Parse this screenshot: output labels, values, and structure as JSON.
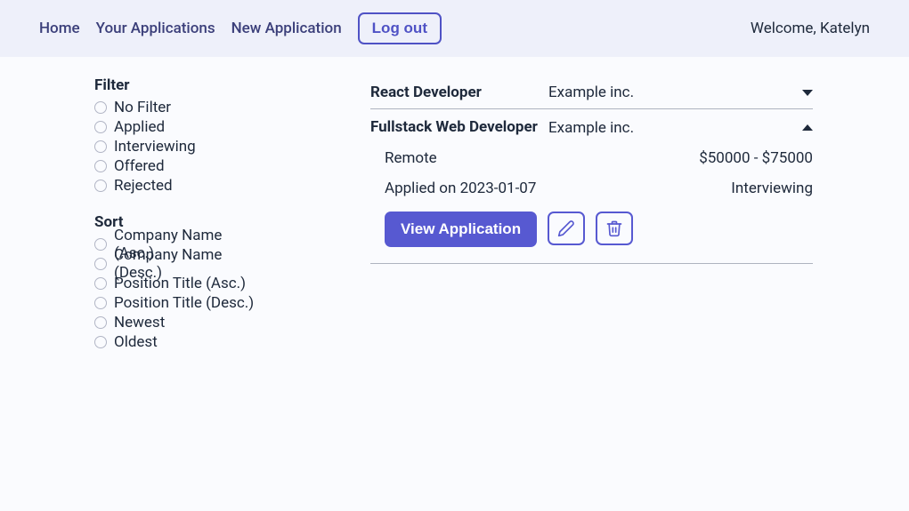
{
  "nav": {
    "home": "Home",
    "your_apps": "Your Applications",
    "new_app": "New Application",
    "logout": "Log out"
  },
  "welcome": "Welcome, Katelyn",
  "sidebar": {
    "filter_heading": "Filter",
    "filters": [
      "No Filter",
      "Applied",
      "Interviewing",
      "Offered",
      "Rejected"
    ],
    "sort_heading": "Sort",
    "sorts": [
      "Company Name (Asc.)",
      "Company Name (Desc.)",
      "Position Title (Asc.)",
      "Position Title (Desc.)",
      "Newest",
      "Oldest"
    ]
  },
  "applications": [
    {
      "title": "React Developer",
      "company": "Example inc.",
      "expanded": false
    },
    {
      "title": "Fullstack Web Developer",
      "company": "Example inc.",
      "expanded": true,
      "location": "Remote",
      "salary": "$50000 - $75000",
      "applied_on": "Applied on 2023-01-07",
      "status": "Interviewing"
    }
  ],
  "buttons": {
    "view": "View Application"
  },
  "colors": {
    "accent": "#5759d1",
    "accent_dark": "#4f52c5",
    "topbar_bg": "#eef0fa",
    "text": "#1e293b",
    "border": "#aeb3bf"
  }
}
